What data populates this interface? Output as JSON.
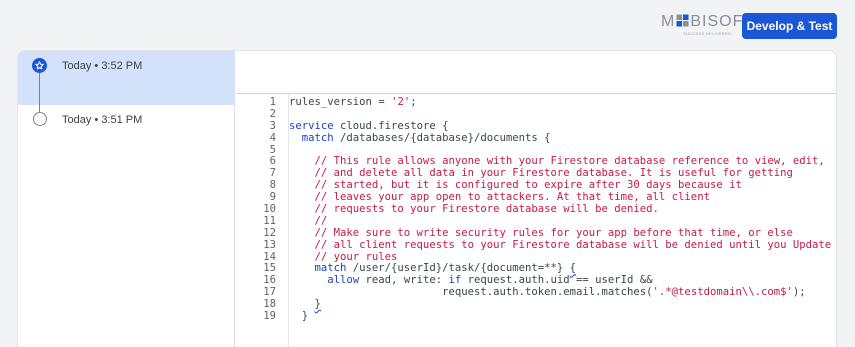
{
  "header": {
    "logo_text": "MOBISOFT",
    "logo_tagline": "SUCCESS DELIVERED",
    "develop_button": "Develop & Test",
    "brand_color": "#1a57d6"
  },
  "history": {
    "items": [
      {
        "time": "Today • 3:52 PM",
        "active": true,
        "icon": "star-icon"
      },
      {
        "time": "Today • 3:51 PM",
        "active": false,
        "icon": "ring-icon"
      }
    ]
  },
  "editor": {
    "line_numbers": [
      "1",
      "2",
      "3",
      "4",
      "5",
      "6",
      "7",
      "8",
      "9",
      "10",
      "11",
      "12",
      "13",
      "14",
      "15",
      "16",
      "17",
      "18",
      "19"
    ],
    "lines": [
      [
        {
          "t": "rules_version = ",
          "c": "pl"
        },
        {
          "t": "'2'",
          "c": "str"
        },
        {
          "t": ";",
          "c": "pl"
        }
      ],
      [],
      [
        {
          "t": "service",
          "c": "kw"
        },
        {
          "t": " cloud.firestore {",
          "c": "pl"
        }
      ],
      [
        {
          "t": "  ",
          "c": "pl"
        },
        {
          "t": "match",
          "c": "kw"
        },
        {
          "t": " /databases/{database}/documents {",
          "c": "pl"
        }
      ],
      [],
      [
        {
          "t": "    // This rule allows anyone with your Firestore database reference to view, edit,",
          "c": "cm"
        }
      ],
      [
        {
          "t": "    // and delete all data in your Firestore database. It is useful for getting",
          "c": "cm"
        }
      ],
      [
        {
          "t": "    // started, but it is configured to expire after 30 days because it",
          "c": "cm"
        }
      ],
      [
        {
          "t": "    // leaves your app open to attackers. At that time, all client",
          "c": "cm"
        }
      ],
      [
        {
          "t": "    // requests to your Firestore database will be denied.",
          "c": "cm"
        }
      ],
      [
        {
          "t": "    //",
          "c": "cm"
        }
      ],
      [
        {
          "t": "    // Make sure to write security rules for your app before that time, or else",
          "c": "cm"
        }
      ],
      [
        {
          "t": "    // all client requests to your Firestore database will be denied until you Update",
          "c": "cm"
        }
      ],
      [
        {
          "t": "    // your rules",
          "c": "cm"
        }
      ],
      [
        {
          "t": "    ",
          "c": "pl"
        },
        {
          "t": "match",
          "c": "kw"
        },
        {
          "t": " /user/{userId}/task/{document=**} ",
          "c": "pl"
        },
        {
          "t": "{",
          "c": "pl squig"
        }
      ],
      [
        {
          "t": "      ",
          "c": "pl"
        },
        {
          "t": "allow",
          "c": "kw"
        },
        {
          "t": " read, write: ",
          "c": "pl"
        },
        {
          "t": "if",
          "c": "kw"
        },
        {
          "t": " request.auth.uid == userId &&",
          "c": "pl"
        }
      ],
      [
        {
          "t": "                        request.auth.token.email.matches(",
          "c": "pl"
        },
        {
          "t": "'.*@testdomain\\\\.com$'",
          "c": "str"
        },
        {
          "t": ");",
          "c": "pl"
        }
      ],
      [
        {
          "t": "    ",
          "c": "pl"
        },
        {
          "t": "}",
          "c": "pl squig"
        }
      ],
      [
        {
          "t": "  }",
          "c": "pl"
        }
      ]
    ]
  }
}
